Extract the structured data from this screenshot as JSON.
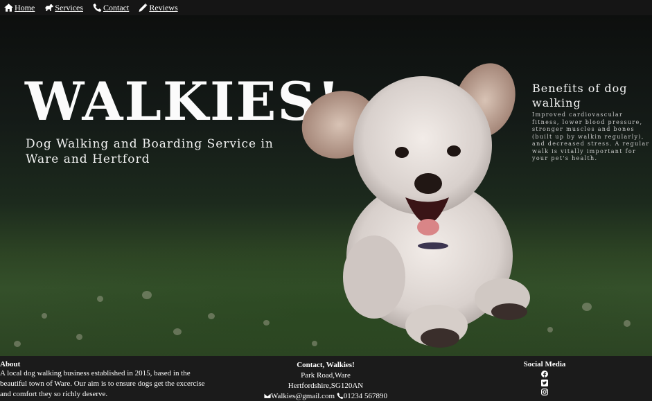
{
  "nav": {
    "items": [
      {
        "label": "Home",
        "icon": "home-icon"
      },
      {
        "label": "Services",
        "icon": "dog-icon"
      },
      {
        "label": "Contact",
        "icon": "phone-icon"
      },
      {
        "label": "Reviews",
        "icon": "pencil-icon"
      }
    ]
  },
  "hero": {
    "title": "WALKIES!",
    "subtitle": "Dog Walking and Boarding Service in Ware and Hertford"
  },
  "benefits": {
    "heading": "Benefits of dog walking",
    "text": "Improved cardiovascular fitness, lower blood pressure, stronger muscles and bones (built up by walkin   regularly), and decreased stress. A regular walk is vitally important for your pet's health."
  },
  "footer": {
    "about": {
      "heading": "About",
      "text": "A local dog walking business established in 2015, based in the beautiful town of Ware. Our aim is to ensure dogs get the excercise and comfort they so richly deserve."
    },
    "contact": {
      "heading": "Contact, Walkies!",
      "address_line1": "Park Road,Ware",
      "address_line2": "Hertfordshire,SG120AN",
      "email": "Walkies@gmail.com",
      "phone": "01234 567890"
    },
    "social": {
      "heading": "Social Media",
      "icons": [
        "facebook-icon",
        "twitter-icon",
        "instagram-icon"
      ]
    }
  }
}
